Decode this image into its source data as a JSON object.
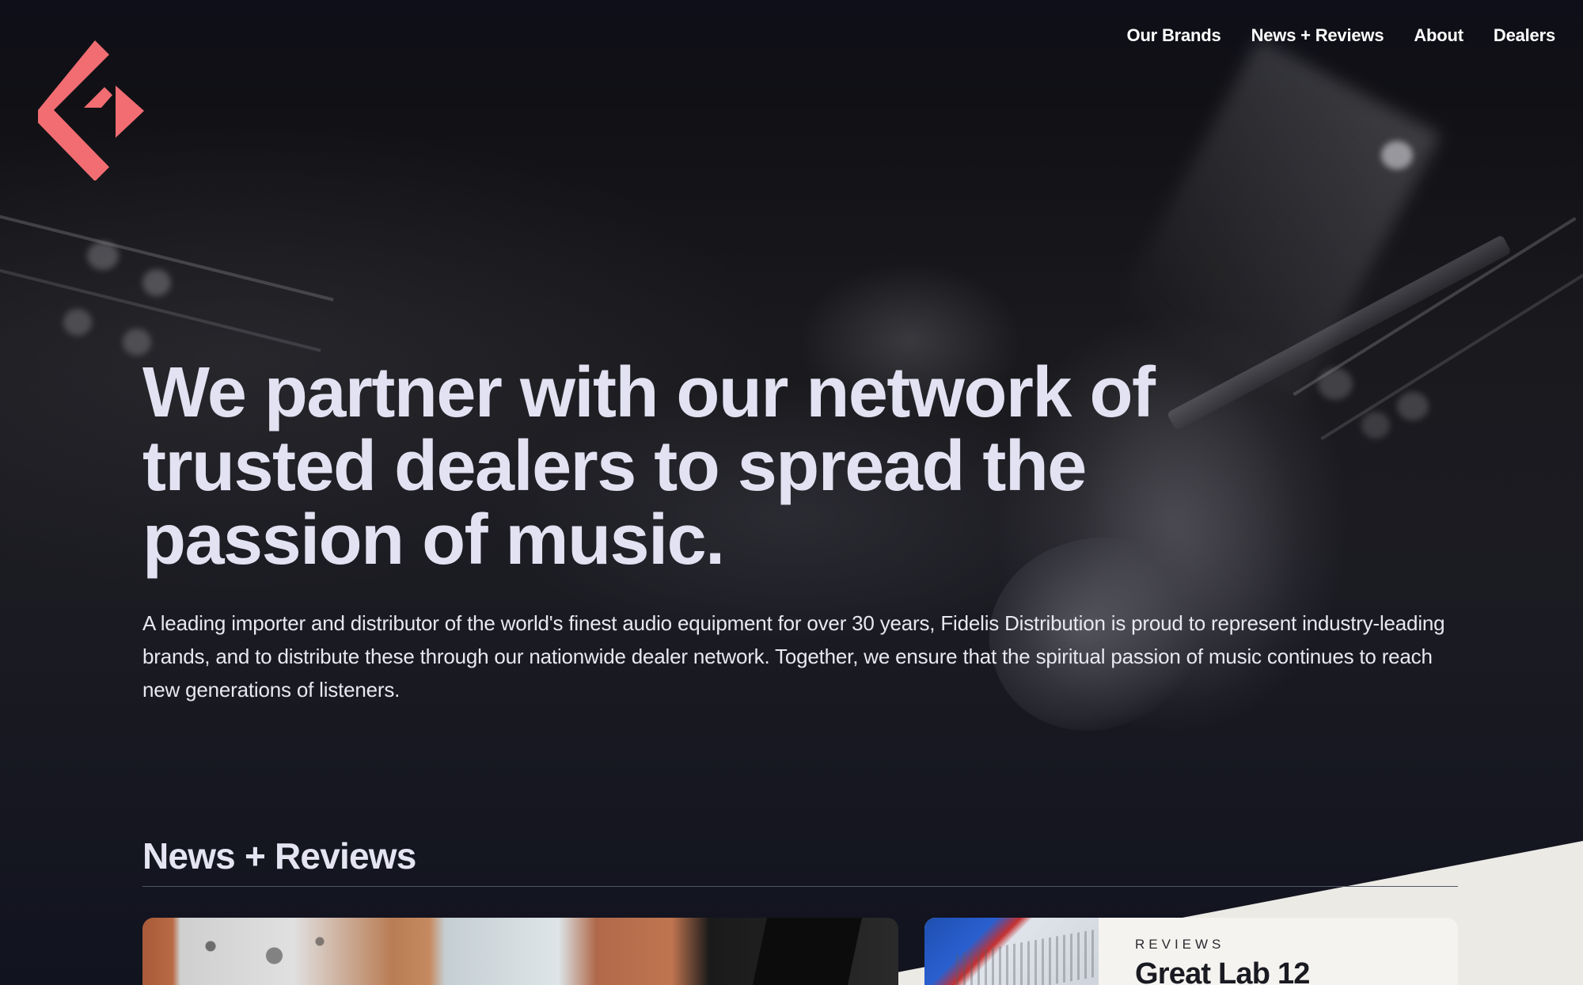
{
  "brand": {
    "logo_icon": "fidelis-f-logo-icon",
    "accent_color": "#f26d72"
  },
  "nav": {
    "items": [
      {
        "label": "Our Brands"
      },
      {
        "label": "News + Reviews"
      },
      {
        "label": "About"
      },
      {
        "label": "Dealers"
      }
    ]
  },
  "hero": {
    "headline": "We partner with our network of trusted dealers to spread the passion of music.",
    "intro": "A leading importer and distributor of the world's finest audio equipment for over 30 years, Fidelis Distribution is proud to represent industry-leading brands, and to distribute these through our nationwide dealer network. Together, we ensure that the spiritual passion of music continues to reach new generations of listeners."
  },
  "news": {
    "section_title": "News + Reviews",
    "review_card": {
      "kicker": "REVIEWS",
      "title": "Great Lab 12"
    }
  },
  "colors": {
    "background": "#0d0e16",
    "headline": "#e2e2f2",
    "cream": "#ebeae5"
  }
}
